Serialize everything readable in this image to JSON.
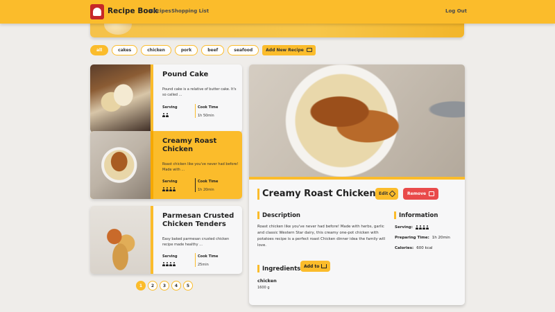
{
  "header": {
    "brand": "Recipe Book",
    "nav": [
      "Recipes",
      "Shopping List"
    ],
    "logout": "Log Out"
  },
  "filters": {
    "chips": [
      "all",
      "cakes",
      "chicken",
      "pork",
      "beef",
      "seafood"
    ],
    "active": "all",
    "add_label": "Add New Recipe"
  },
  "recipes": [
    {
      "title": "Pound Cake",
      "description": "Pound cake is a relative of butter cake. It's so called ...",
      "serving_label": "Serving",
      "serving_count": 2,
      "cook_label": "Cook Time",
      "cook_time": "1h 50min"
    },
    {
      "title": "Creamy Roast Chicken",
      "description": "Roast chicken like you've never had before! Made with ...",
      "serving_label": "Serving",
      "serving_count": 4,
      "cook_label": "Cook Time",
      "cook_time": "1h 20min",
      "selected": true
    },
    {
      "title": "Parmesan Crusted Chicken Tenders",
      "description": "Easy baked parmesan crusted chicken recipe made healthy ...",
      "serving_label": "Serving",
      "serving_count": 4,
      "cook_label": "Cook Time",
      "cook_time": "25min"
    }
  ],
  "pagination": {
    "pages": [
      "1",
      "2",
      "3",
      "4",
      "5"
    ],
    "current": "1"
  },
  "detail": {
    "title": "Creamy Roast Chicken",
    "edit_label": "Edit",
    "remove_label": "Remove",
    "description_heading": "Description",
    "description": "Roast chicken like you've never had before! Made with herbs, garlic and classic Western Star dairy, this creamy one-pot chicken with potatoes recipe is a perfect roast Chicken dinner idea the family will love.",
    "information_heading": "Information",
    "serving_label": "Serving:",
    "serving_count": 4,
    "prep_label": "Preparing Time:",
    "prep_time": "1h 20min",
    "calories_label": "Calories:",
    "calories": "600 kcal",
    "ingredients_heading": "Ingredients",
    "add_to_label": "Add to",
    "ingredients": [
      {
        "name": "chicken",
        "qty": "1600 g"
      }
    ]
  }
}
